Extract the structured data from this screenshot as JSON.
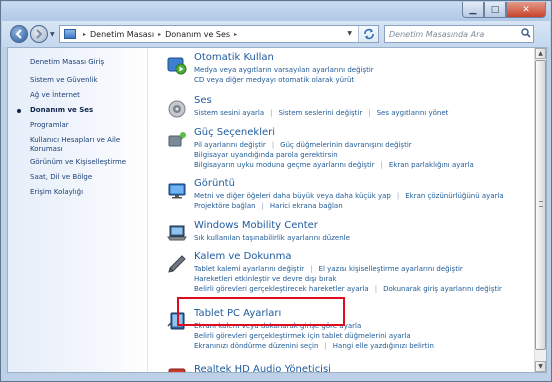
{
  "window": {
    "minimize_glyph": "▁",
    "maximize_glyph": "□",
    "close_glyph": "✕"
  },
  "address": {
    "crumbs": [
      "Denetim Masası",
      "Donanım ve Ses"
    ],
    "separator": "▸",
    "search_placeholder": "Denetim Masasında Ara"
  },
  "sidebar": {
    "items": [
      {
        "label": "Denetim Masası Giriş"
      },
      {
        "label": "Sistem ve Güvenlik"
      },
      {
        "label": "Ağ ve İnternet"
      },
      {
        "label": "Donanım ve Ses",
        "active": true
      },
      {
        "label": "Programlar"
      },
      {
        "label": "Kullanıcı Hesapları ve Aile Koruması"
      },
      {
        "label": "Görünüm ve Kişiselleştirme"
      },
      {
        "label": "Saat, Dil ve Bölge"
      },
      {
        "label": "Erişim Kolaylığı"
      }
    ]
  },
  "categories": [
    {
      "title": "Otomatik Kullan",
      "icon": "autoplay-icon",
      "lines": [
        [
          "Medya veya aygıtların varsayılan ayarlarını değiştir"
        ],
        [
          "CD veya diğer medyayı otomatik olarak yürüt"
        ]
      ]
    },
    {
      "title": "Ses",
      "icon": "speaker-icon",
      "lines": [
        [
          "Sistem sesini ayarla",
          "Sistem seslerini değiştir",
          "Ses aygıtlarını yönet"
        ]
      ]
    },
    {
      "title": "Güç Seçenekleri",
      "icon": "power-options-icon",
      "lines": [
        [
          "Pil ayarlarını değiştir",
          "Güç düğmelerinin davranışını değiştir"
        ],
        [
          "Bilgisayar uyandığında parola gerektirsin"
        ],
        [
          "Bilgisayarın uyku moduna geçme ayarlarını değiştir",
          "Ekran parlaklığını ayarla"
        ]
      ]
    },
    {
      "title": "Görüntü",
      "icon": "display-icon",
      "lines": [
        [
          "Metni ve diğer öğeleri daha büyük veya daha küçük yap",
          "Ekran çözünürlüğünü ayarla"
        ],
        [
          "Projektöre bağlan",
          "Harici ekrana bağlan"
        ]
      ]
    },
    {
      "title": "Windows Mobility Center",
      "icon": "mobility-center-icon",
      "lines": [
        [
          "Sık kullanılan taşınabilirlik ayarlarını düzenle"
        ]
      ]
    },
    {
      "title": "Kalem ve Dokunma",
      "icon": "pen-icon",
      "lines": [
        [
          "Tablet kalemi ayarlarını değiştir",
          "El yazısı kişiselleştirme ayarlarını değiştir"
        ],
        [
          "Hareketleri etkinleştir ve devre dışı bırak"
        ],
        [
          "Belirli görevleri gerçekleştirecek hareketler ayarla",
          "Dokunarak giriş ayarlarını değiştir"
        ]
      ]
    },
    {
      "title": "Tablet PC Ayarları",
      "icon": "tablet-pc-icon",
      "lines": [
        [
          "Ekranı kalem veya dokunarak girişe göre ayarla"
        ],
        [
          "Belirli görevleri gerçekleştirmek için tablet düğmelerini ayarla"
        ],
        [
          "Ekranınızı döndürme düzenini seçin",
          "Hangi elle yazdığınızı belirtin"
        ]
      ]
    },
    {
      "title": "Realtek HD Audio Yöneticisi",
      "icon": "realtek-audio-icon",
      "lines": []
    }
  ],
  "colors": {
    "link": "#1f5b97",
    "title": "#1d5a9e",
    "highlight": "#e00c1e"
  }
}
